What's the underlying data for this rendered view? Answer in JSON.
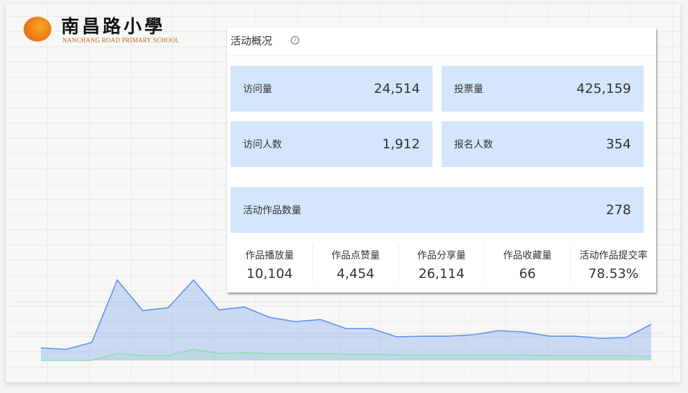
{
  "logo": {
    "cn": "南昌路小學",
    "en": "NANCHANG ROAD PRIMARY SCHOOL"
  },
  "panel": {
    "title": "活动概况",
    "info_icon": "i"
  },
  "cards": [
    {
      "label": "访问量",
      "value": "24,514"
    },
    {
      "label": "投票量",
      "value": "425,159"
    },
    {
      "label": "访问人数",
      "value": "1,912"
    },
    {
      "label": "报名人数",
      "value": "354"
    },
    {
      "label": "活动作品数量",
      "value": "278"
    }
  ],
  "stats": [
    {
      "label": "作品播放量",
      "value": "10,104"
    },
    {
      "label": "作品点赞量",
      "value": "4,454"
    },
    {
      "label": "作品分享量",
      "value": "26,114"
    },
    {
      "label": "作品收藏量",
      "value": "66"
    },
    {
      "label": "活动作品提交率",
      "value": "78.53%"
    }
  ],
  "chart_data": {
    "type": "area",
    "title": "",
    "xlabel": "",
    "ylabel": "",
    "series": [
      {
        "name": "blue",
        "color": "#5b8ff0",
        "values": [
          18,
          16,
          26,
          116,
          72,
          76,
          116,
          73,
          77,
          62,
          56,
          59,
          46,
          46,
          34,
          35,
          35,
          37,
          43,
          41,
          35,
          35,
          32,
          33,
          52
        ]
      },
      {
        "name": "green",
        "color": "#8fdcae",
        "values": [
          0,
          0,
          0,
          10,
          7,
          7,
          16,
          10,
          11,
          10,
          10,
          10,
          9,
          9,
          8,
          8,
          8,
          8,
          8,
          8,
          7,
          7,
          7,
          7,
          6
        ]
      }
    ]
  }
}
